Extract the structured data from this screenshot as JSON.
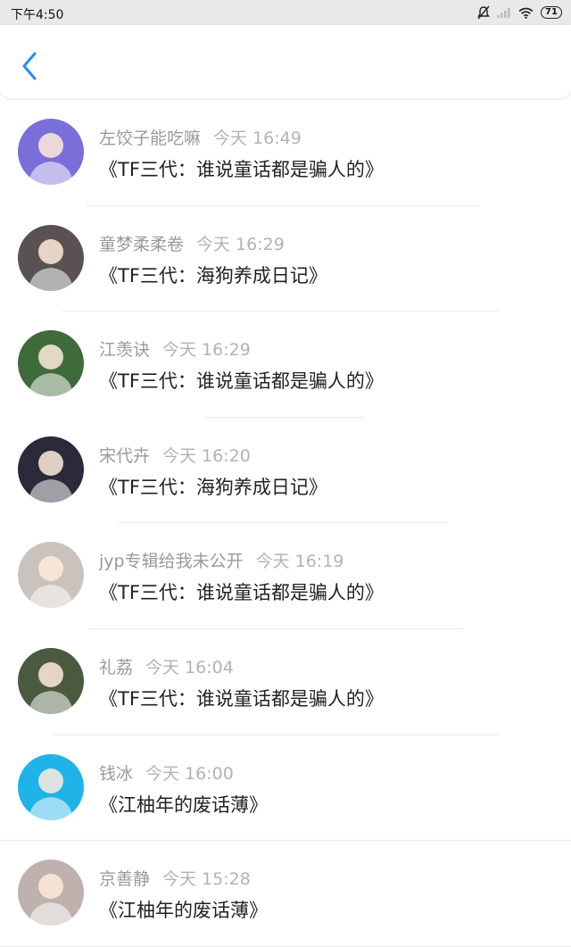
{
  "status_bar": {
    "time": "下午4:50",
    "battery": "71",
    "icons": [
      "mute-icon",
      "signal-icon",
      "wifi-icon",
      "battery-icon"
    ]
  },
  "nav": {
    "back_icon": "chevron-left-icon",
    "accent": "#2a8de8"
  },
  "items": [
    {
      "name": "左饺子能吃嘛",
      "time": "今天 16:49",
      "title": "《TF三代：谁说童话都是骗人的》",
      "avatar_color": "#7a6fd8"
    },
    {
      "name": "童梦柔柔卷",
      "time": "今天 16:29",
      "title": "《TF三代：海狗养成日记》",
      "avatar_color": "#5a5252"
    },
    {
      "name": "江羡诀",
      "time": "今天 16:29",
      "title": "《TF三代：谁说童话都是骗人的》",
      "avatar_color": "#3f6a3a"
    },
    {
      "name": "宋代卉",
      "time": "今天 16:20",
      "title": "《TF三代：海狗养成日记》",
      "avatar_color": "#2b2a3a"
    },
    {
      "name": "jyp专辑给我未公开",
      "time": "今天 16:19",
      "title": "《TF三代：谁说童话都是骗人的》",
      "avatar_color": "#c9c2bd"
    },
    {
      "name": "礼荔",
      "time": "今天 16:04",
      "title": "《TF三代：谁说童话都是骗人的》",
      "avatar_color": "#4b5a3e"
    },
    {
      "name": "钱冰",
      "time": "今天 16:00",
      "title": "《江柚年的废话薄》",
      "avatar_color": "#1fb3e8"
    },
    {
      "name": "京善静",
      "time": "今天 15:28",
      "title": "《江柚年的废话薄》",
      "avatar_color": "#bfb1ae"
    }
  ]
}
